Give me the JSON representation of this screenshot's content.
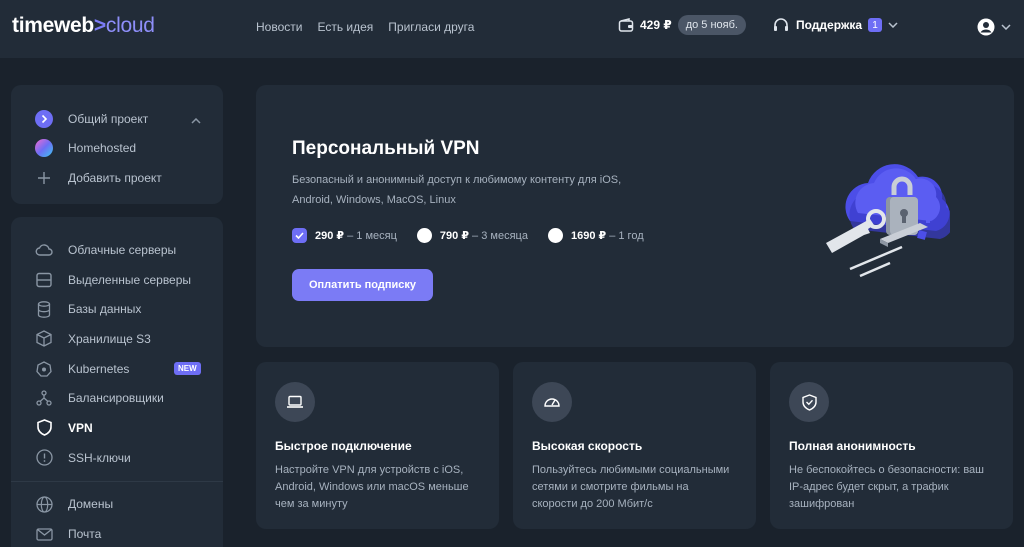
{
  "header": {
    "logo_main": "timeweb",
    "logo_arrow": ">",
    "logo_cloud": "cloud",
    "nav": [
      {
        "label": "Новости"
      },
      {
        "label": "Есть идея"
      },
      {
        "label": "Пригласи друга"
      }
    ],
    "balance_amount": "429 ₽",
    "balance_until": "до 5 нояб.",
    "support_label": "Поддержка",
    "support_count": "1"
  },
  "projects": {
    "items": [
      {
        "label": "Общий проект"
      },
      {
        "label": "Homehosted"
      },
      {
        "label": "Добавить проект"
      }
    ]
  },
  "sidebar": {
    "items": [
      {
        "label": "Облачные серверы"
      },
      {
        "label": "Выделенные серверы"
      },
      {
        "label": "Базы данных"
      },
      {
        "label": "Хранилище S3"
      },
      {
        "label": "Kubernetes",
        "badge": "NEW"
      },
      {
        "label": "Балансировщики"
      },
      {
        "label": "VPN",
        "active": true
      },
      {
        "label": "SSH-ключи"
      },
      {
        "label": "Домены"
      },
      {
        "label": "Почта"
      }
    ]
  },
  "hero": {
    "title": "Персональный VPN",
    "description": "Безопасный и анонимный доступ к любимому контенту для iOS, Android, Windows, MacOS, Linux",
    "plans": [
      {
        "price": "290 ₽",
        "period": " – 1 месяц",
        "selected": true
      },
      {
        "price": "790 ₽",
        "period": " – 3 месяца",
        "selected": false
      },
      {
        "price": "1690 ₽",
        "period": " – 1 год",
        "selected": false
      }
    ],
    "pay_button": "Оплатить подписку"
  },
  "features": [
    {
      "title": "Быстрое подключение",
      "text": "Настройте VPN для устройств с iOS, Android, Windows или macOS меньше чем за минуту"
    },
    {
      "title": "Высокая скорость",
      "text": "Пользуйтесь любимыми социальными сетями и смотрите фильмы на скорости до 200 Мбит/с"
    },
    {
      "title": "Полная анонимность",
      "text": "Не беспокойтесь о безопасности: ваш IP-адрес будет скрыт, а трафик зашифрован"
    }
  ],
  "colors": {
    "accent": "#6e6ef5",
    "background": "#1a222c",
    "card": "#222c38"
  }
}
